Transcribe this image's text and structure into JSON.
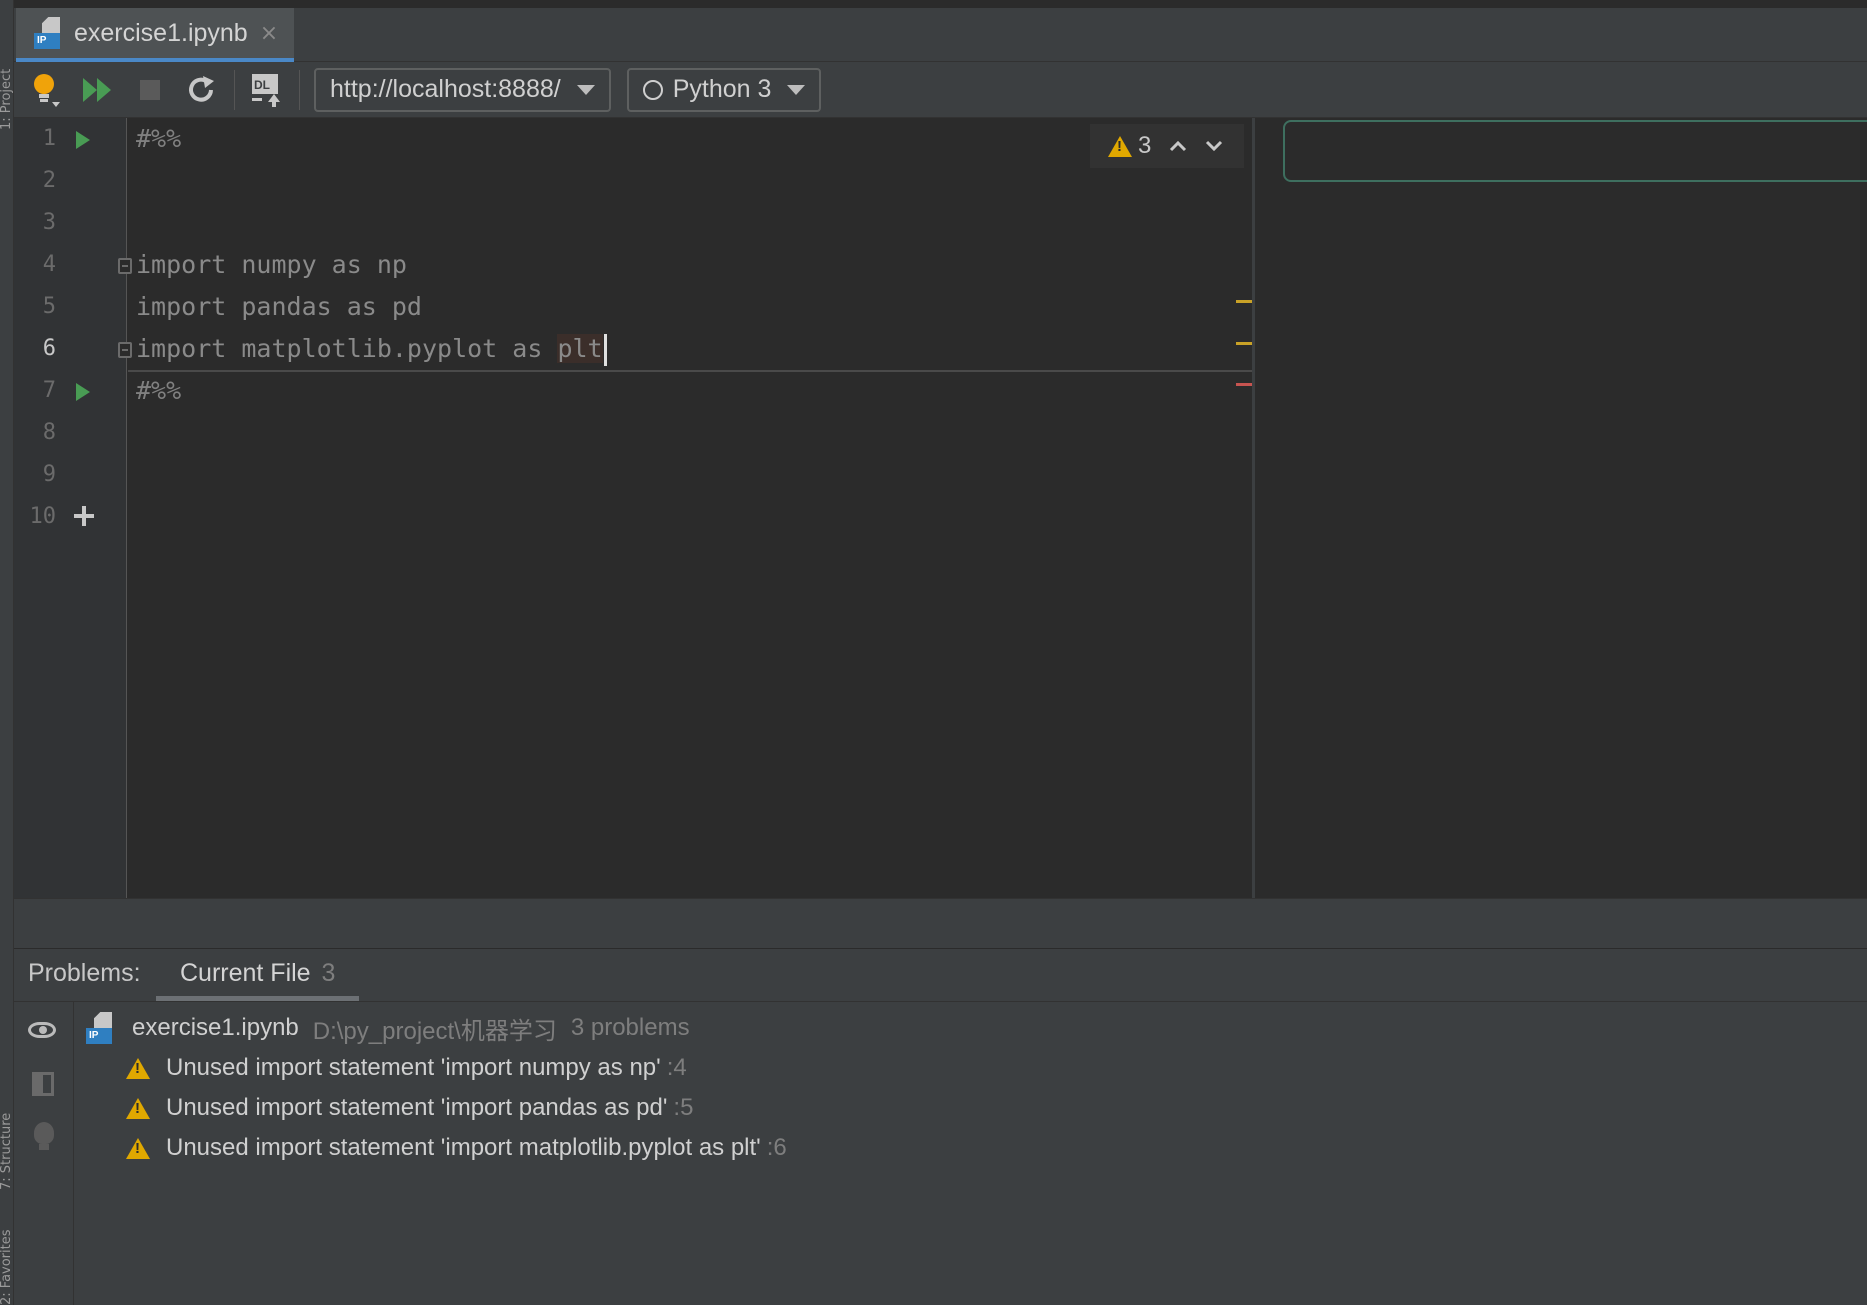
{
  "side_strip": {
    "project_label": "1: Project",
    "structure_label": "7: Structure",
    "favorites_label": "2: Favorites"
  },
  "tab": {
    "title": "exercise1.ipynb",
    "file_badge": "IP",
    "close_glyph": "×"
  },
  "toolbar": {
    "server_url": "http://localhost:8888/",
    "kernel": "Python 3",
    "icons": [
      "bulb-icon",
      "run-all-icon",
      "stop-icon",
      "restart-icon",
      "dl-icon"
    ],
    "dl_text": "DL"
  },
  "editor": {
    "lines": [
      {
        "num": "1",
        "text": "#%%",
        "run": true
      },
      {
        "num": "2",
        "text": ""
      },
      {
        "num": "3",
        "text": ""
      },
      {
        "num": "4",
        "text": "import numpy as np"
      },
      {
        "num": "5",
        "text": "import pandas as pd"
      },
      {
        "num": "6",
        "text_prefix": "import matplotlib.pyplot as ",
        "text_highlight": "plt",
        "current": true
      },
      {
        "num": "7",
        "text": "#%%",
        "run": true
      },
      {
        "num": "8",
        "text": ""
      },
      {
        "num": "9",
        "text": ""
      },
      {
        "num": "10",
        "text": "",
        "add": true
      }
    ],
    "inspection": {
      "warning_count": "3",
      "up_glyph": "⌃",
      "down_glyph": "⌄"
    },
    "colors": {
      "run_arrow": "#499c54",
      "warning_stripe": "#c9a227",
      "error_stripe": "#c75450"
    }
  },
  "problems": {
    "title": "Problems:",
    "tab_label": "Current File",
    "tab_count": "3",
    "file": {
      "name": "exercise1.ipynb",
      "path": "D:\\py_project\\机器学习",
      "count_text": "3 problems"
    },
    "items": [
      {
        "message": "Unused import statement 'import numpy as np'",
        "line": ":4"
      },
      {
        "message": "Unused import statement 'import pandas as pd'",
        "line": ":5"
      },
      {
        "message": "Unused import statement 'import matplotlib.pyplot as plt'",
        "line": ":6"
      }
    ]
  }
}
